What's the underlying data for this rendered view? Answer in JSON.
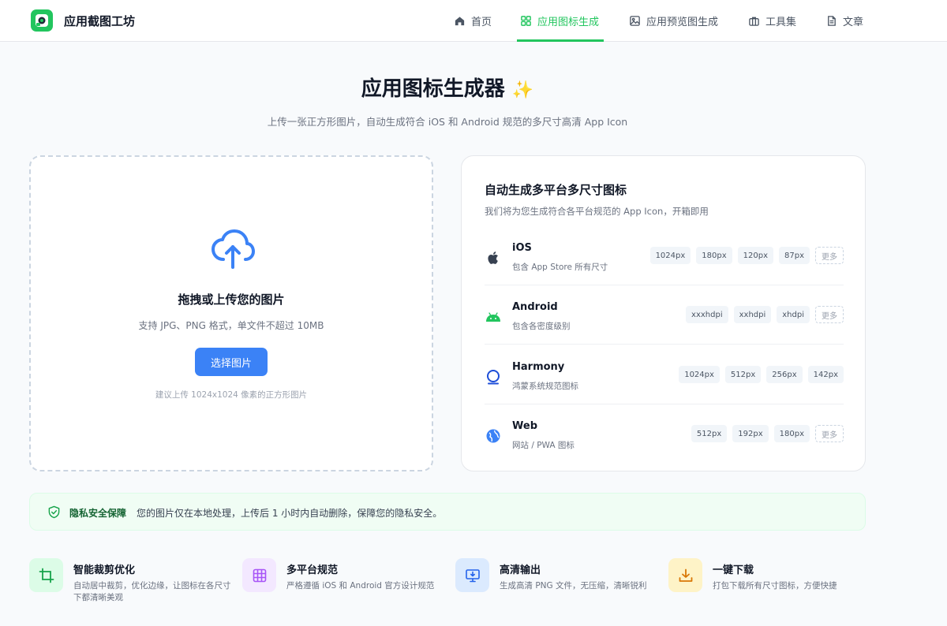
{
  "app": {
    "title": "应用截图工坊"
  },
  "nav": {
    "home": "首页",
    "icon_gen": "应用图标生成",
    "preview_gen": "应用预览图生成",
    "tools": "工具集",
    "articles": "文章"
  },
  "page": {
    "title": "应用图标生成器",
    "sparkle": "✨",
    "subtitle": "上传一张正方形图片，自动生成符合 iOS 和 Android 规范的多尺寸高清 App Icon"
  },
  "upload": {
    "title": "拖拽或上传您的图片",
    "desc": "支持 JPG、PNG 格式，单文件不超过 10MB",
    "button": "选择图片",
    "hint": "建议上传 1024x1024 像素的正方形图片"
  },
  "platforms": {
    "title": "自动生成多平台多尺寸图标",
    "subtitle": "我们将为您生成符合各平台规范的 App Icon，开箱即用",
    "items": [
      {
        "name": "iOS",
        "desc": "包含 App Store 所有尺寸",
        "icon": "apple-icon",
        "tags": [
          "1024px",
          "180px",
          "120px",
          "87px"
        ],
        "more": "更多"
      },
      {
        "name": "Android",
        "desc": "包含各密度级别",
        "icon": "android-icon",
        "tags": [
          "xxxhdpi",
          "xxhdpi",
          "xhdpi"
        ],
        "more": "更多"
      },
      {
        "name": "Harmony",
        "desc": "鸿蒙系统规范图标",
        "icon": "harmony-icon",
        "tags": [
          "1024px",
          "512px",
          "256px",
          "142px"
        ],
        "more": ""
      },
      {
        "name": "Web",
        "desc": "网站 / PWA 图标",
        "icon": "globe-icon",
        "tags": [
          "512px",
          "192px",
          "180px"
        ],
        "more": "更多"
      }
    ]
  },
  "privacy": {
    "title": "隐私安全保障",
    "text": "您的图片仅在本地处理，上传后 1 小时内自动删除，保障您的隐私安全。"
  },
  "features": [
    {
      "title": "智能裁剪优化",
      "desc": "自动居中裁剪，优化边缘，让图标在各尺寸下都清晰美观",
      "icon": "crop-icon"
    },
    {
      "title": "多平台规范",
      "desc": "严格遵循 iOS 和 Android 官方设计规范",
      "icon": "grid-icon"
    },
    {
      "title": "高清输出",
      "desc": "生成高清 PNG 文件，无压缩，清晰锐利",
      "icon": "monitor-icon"
    },
    {
      "title": "一键下载",
      "desc": "打包下载所有尺寸图标，方便快捷",
      "icon": "download-icon"
    }
  ],
  "colors": {
    "accent_green": "#22c55e",
    "primary_blue": "#3b82f6"
  }
}
